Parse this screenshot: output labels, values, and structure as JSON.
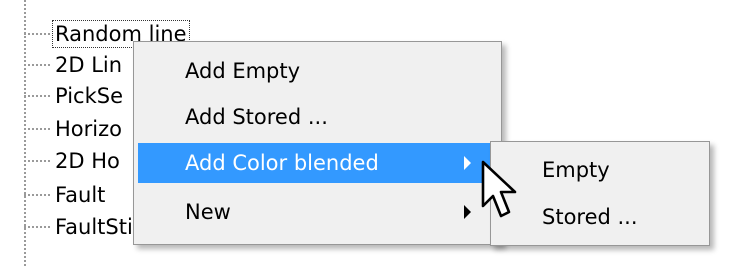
{
  "tree": {
    "items": [
      {
        "label": "Random line"
      },
      {
        "label": "2D Lin"
      },
      {
        "label": "PickSe"
      },
      {
        "label": "Horizo"
      },
      {
        "label": "2D Ho"
      },
      {
        "label": "Fault"
      },
      {
        "label": "FaultStickSet"
      }
    ]
  },
  "context_menu": {
    "items": [
      {
        "label": "Add Empty"
      },
      {
        "label": "Add Stored ..."
      },
      {
        "label": "Add Color blended"
      },
      {
        "label": "New"
      }
    ]
  },
  "submenu": {
    "items": [
      {
        "label": "Empty"
      },
      {
        "label": "Stored ..."
      }
    ]
  },
  "colors": {
    "highlight": "#3399ff",
    "menu_background": "#f0f0f0"
  },
  "icons": {
    "cursor": "mouse-pointer-icon",
    "submenu_arrow": "chevron-right-icon"
  }
}
